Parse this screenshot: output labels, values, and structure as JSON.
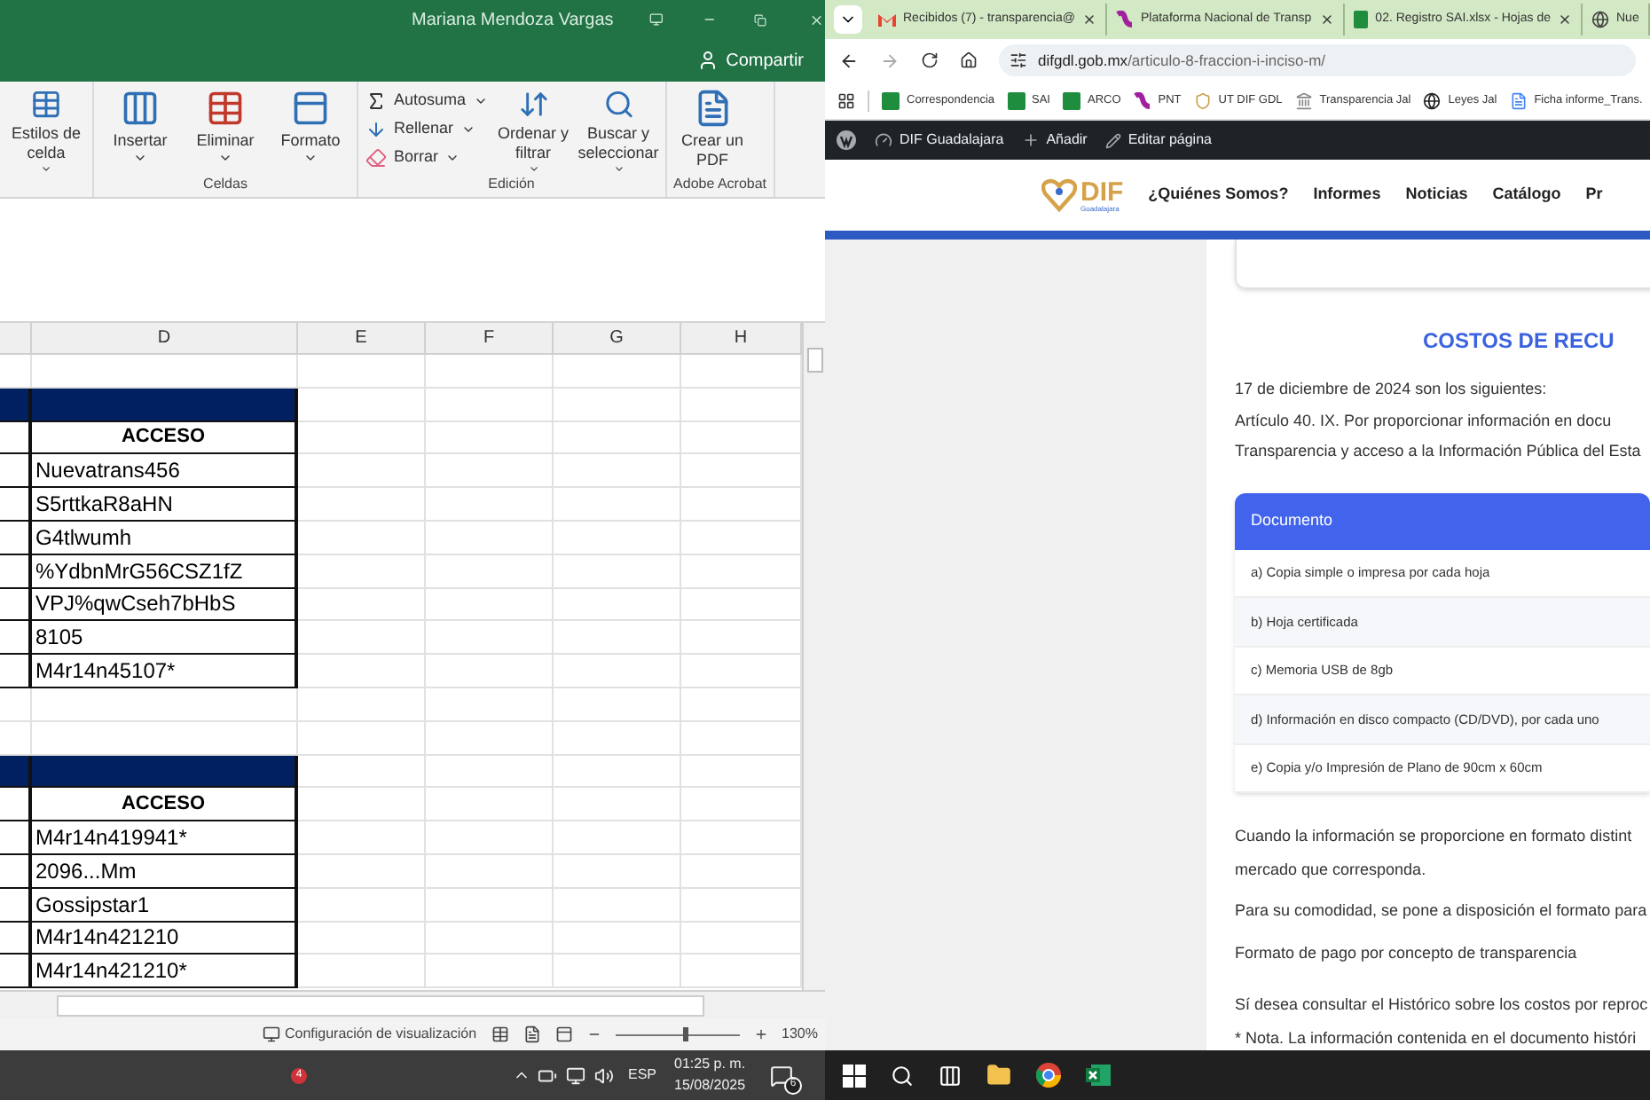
{
  "excel": {
    "user": "Mariana Mendoza Vargas",
    "share": "Compartir",
    "ribbon": [
      {
        "buttons": [
          {
            "kind": "large",
            "label": "Estilos de celda",
            "menu": true
          }
        ]
      },
      {
        "label": "Celdas",
        "buttons": [
          {
            "kind": "large",
            "label": "Insertar",
            "menu": true
          },
          {
            "kind": "large",
            "label": "Eliminar",
            "menu": true
          },
          {
            "kind": "large",
            "label": "Formato",
            "menu": true
          }
        ]
      },
      {
        "label": "Edición",
        "buttons": [
          {
            "kind": "small",
            "label": "Autosuma",
            "menu": true
          },
          {
            "kind": "small",
            "label": "Rellenar",
            "menu": true
          },
          {
            "kind": "small",
            "label": "Borrar",
            "menu": true
          },
          {
            "kind": "large",
            "label": "Ordenar y filtrar",
            "menu": true
          },
          {
            "kind": "large",
            "label": "Buscar y seleccionar",
            "menu": true
          }
        ]
      },
      {
        "label": "Adobe Acrobat",
        "buttons": [
          {
            "kind": "large",
            "label": "Crear un PDF",
            "menu": false
          }
        ]
      }
    ],
    "columns": [
      "D",
      "E",
      "F",
      "G",
      "H"
    ],
    "blocks": [
      {
        "header": "ACCESO",
        "values": [
          "Nuevatrans456",
          "S5rttkaR8aHN",
          "G4tlwumh",
          "%YdbnMrG56CSZ1fZ",
          "VPJ%qwCseh7bHbS",
          "8105",
          "M4r14n45107*"
        ]
      },
      {
        "header": "ACCESO",
        "values": [
          "M4r14n419941*",
          "2096...Mm",
          "Gossipstar1",
          "M4r14n421210",
          "M4r14n421210*"
        ]
      }
    ],
    "status": {
      "display_settings": "Configuración de visualización",
      "zoom": "130%",
      "level": 0.55
    }
  },
  "browser": {
    "tabs": [
      {
        "title": "Recibidos (7) - transparencia@",
        "selected": false,
        "closable": true
      },
      {
        "title": "Plataforma Nacional de Transp",
        "selected": false,
        "closable": true
      },
      {
        "title": "02. Registro SAI.xlsx - Hojas de",
        "selected": false,
        "closable": true
      },
      {
        "title": "Nue",
        "selected": false,
        "closable": false
      }
    ],
    "address": {
      "host": "difgdl.gob.mx",
      "path": "/articulo-8-fraccion-i-inciso-m/"
    },
    "bookmarks": [
      "Correspondencia",
      "SAI",
      "ARCO",
      "PNT",
      "UT DIF GDL",
      "Transparencia Jal",
      "Leyes Jal",
      "Ficha informe_Trans."
    ],
    "admin_bar": [
      "DIF Guadalajara",
      "Añadir",
      "Editar página"
    ],
    "site": {
      "logo": "DIF",
      "logo_sub": "Guadalajara",
      "nav": [
        "¿Quiénes Somos?",
        "Informes",
        "Noticias",
        "Catálogo",
        "Pr"
      ],
      "heading": "COSTOS DE RECU",
      "intro": [
        "17 de diciembre de 2024 son los siguientes:",
        "Artículo 40. IX. Por proporcionar información en docu",
        "Transparencia y acceso a la Información Pública del Esta"
      ],
      "table": {
        "header": "Documento",
        "rows": [
          "a) Copia simple o impresa por cada hoja",
          "b) Hoja certificada",
          "c) Memoria USB de 8gb",
          "d) Información en disco compacto (CD/DVD), por cada uno",
          "e) Copia y/o Impresión de Plano de 90cm x 60cm"
        ]
      },
      "paragraphs": [
        [
          "Cuando la información se proporcione en formato distint",
          "mercado que corresponda."
        ],
        [
          "Para su comodidad, se pone a disposición el formato para"
        ],
        [
          "Formato de pago por concepto de transparencia"
        ],
        [
          "Sí desea consultar el Histórico sobre los costos por reproc",
          "* Nota. La información contenida en el documento históri"
        ]
      ]
    }
  },
  "taskbar": {
    "badge": "4",
    "language": "ESP",
    "time": "01:25 p. m.",
    "date": "15/08/2025",
    "notifications": "6"
  }
}
